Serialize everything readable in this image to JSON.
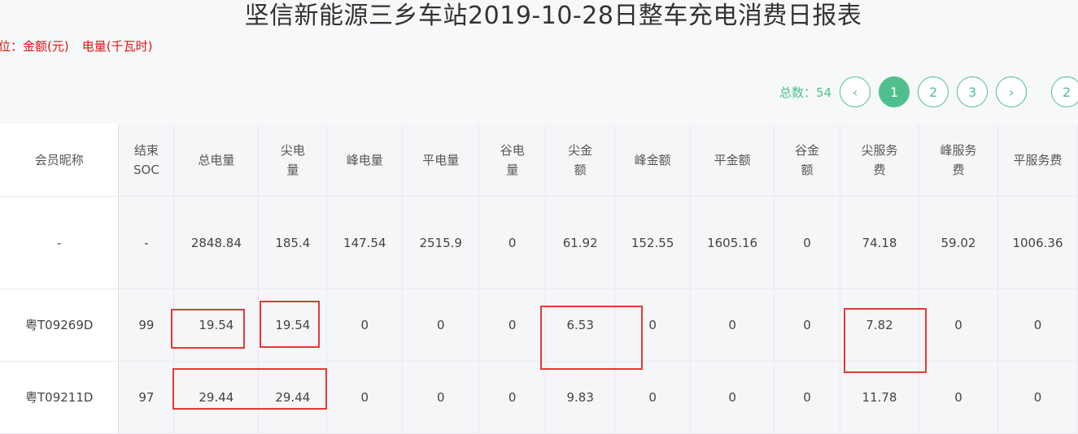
{
  "report": {
    "title": "坚信新能源三乡车站2019-10-28日整车充电消费日报表",
    "unit_label": "位：金额(元)",
    "energy_label": "电量(千瓦时)"
  },
  "pagination": {
    "total_label": "总数：54",
    "prev_icon": "‹",
    "pages": [
      "1",
      "2",
      "3"
    ],
    "next_icon": "›",
    "partial_page": "2",
    "active_page": "1"
  },
  "table": {
    "headers": [
      "会员昵称",
      "结束SOC",
      "总电量",
      "尖电量",
      "峰电量",
      "平电量",
      "谷电量",
      "尖金额",
      "峰金额",
      "平金额",
      "谷金额",
      "尖服务费",
      "峰服务费",
      "平服务费"
    ],
    "rows": [
      [
        "-",
        "-",
        "2848.84",
        "185.4",
        "147.54",
        "2515.9",
        "0",
        "61.92",
        "152.55",
        "1605.16",
        "0",
        "74.18",
        "59.02",
        "1006.36"
      ],
      [
        "粤T09269D",
        "99",
        "19.54",
        "19.54",
        "0",
        "0",
        "0",
        "6.53",
        "0",
        "0",
        "0",
        "7.82",
        "0",
        "0"
      ],
      [
        "粤T09211D",
        "97",
        "29.44",
        "29.44",
        "0",
        "0",
        "0",
        "9.83",
        "0",
        "0",
        "0",
        "11.78",
        "0",
        "0"
      ]
    ]
  },
  "colors": {
    "accent": "#4fc08d",
    "highlight": "#e53935",
    "unit_text": "#e01212"
  }
}
